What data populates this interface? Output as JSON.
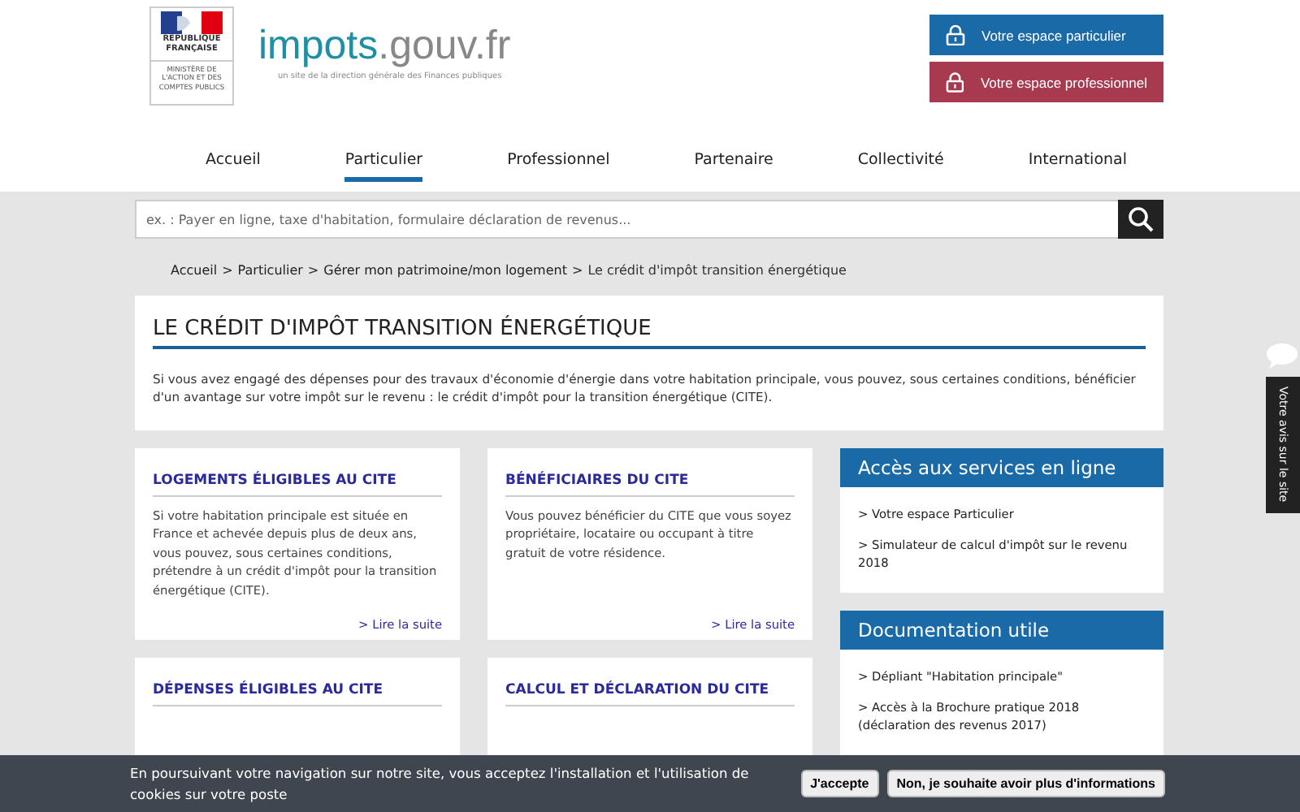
{
  "header": {
    "emblem_caption": "RÉPUBLIQUE FRANÇAISE",
    "ministry": "MINISTÈRE DE L'ACTION ET DES COMPTES PUBLICS",
    "brand_main": "impots",
    "brand_domain": ".gouv.fr",
    "tagline": "un site de la direction générale des Finances publiques",
    "account_buttons": [
      {
        "label": "Votre espace particulier",
        "color": "#1a6aa8"
      },
      {
        "label": "Votre espace professionnel",
        "color": "#a83a50"
      }
    ]
  },
  "nav": [
    {
      "label": "Accueil",
      "selected": false
    },
    {
      "label": "Particulier",
      "selected": true
    },
    {
      "label": "Professionnel",
      "selected": false
    },
    {
      "label": "Partenaire",
      "selected": false
    },
    {
      "label": "Collectivité",
      "selected": false
    },
    {
      "label": "International",
      "selected": false
    }
  ],
  "search": {
    "placeholder": "ex. : Payer en ligne, taxe d'habitation, formulaire déclaration de revenus..."
  },
  "breadcrumb": [
    {
      "text": "Accueil",
      "kind": "link"
    },
    {
      "text": ">",
      "kind": "separator"
    },
    {
      "text": "Particulier",
      "kind": "link"
    },
    {
      "text": ">",
      "kind": "separator"
    },
    {
      "text": "Gérer mon patrimoine/mon logement",
      "kind": "link"
    },
    {
      "text": ">",
      "kind": "separator"
    },
    {
      "text": "Le crédit d'impôt transition énergétique",
      "kind": "current"
    }
  ],
  "intro": {
    "title": "LE CRÉDIT D'IMPÔT TRANSITION ÉNERGÉTIQUE",
    "text": "Si vous avez engagé des dépenses pour des travaux d'économie d'énergie dans votre habitation principale, vous pouvez, sous certaines conditions, bénéficier d'un avantage sur votre impôt sur le revenu : le crédit d'impôt pour la transition énergétique (CITE)."
  },
  "cards": [
    {
      "title": "LOGEMENTS ÉLIGIBLES AU CITE",
      "text": "Si votre habitation principale est située en France et achevée depuis plus de deux ans, vous pouvez, sous certaines conditions, prétendre à un crédit d'impôt pour la transition énergétique (CITE).",
      "link": "> Lire la suite"
    },
    {
      "title": "BÉNÉFICIAIRES DU CITE",
      "text": "Vous pouvez bénéficier du CITE que vous soyez propriétaire, locataire ou occupant à titre gratuit de votre résidence.",
      "link": "> Lire la suite"
    },
    {
      "title": "DÉPENSES ÉLIGIBLES AU CITE"
    },
    {
      "title": "CALCUL ET DÉCLARATION DU CITE"
    }
  ],
  "sidebar": [
    {
      "title": "Accès aux services en ligne",
      "links": [
        "> Votre espace Particulier",
        "> Simulateur de calcul d'impôt sur le revenu 2018"
      ]
    },
    {
      "title": "Documentation utile",
      "links": [
        "> Dépliant \"Habitation principale\"",
        "> Accès à la Brochure pratique 2018 (déclaration des revenus 2017)"
      ]
    }
  ],
  "feedback_tab": {
    "label": "Votre avis sur le site"
  },
  "cookie_banner": {
    "text": "En poursuivant votre navigation sur notre site, vous acceptez l'installation et l'utilisation de cookies sur votre poste",
    "buttons": [
      "J'accepte",
      "Non, je souhaite avoir plus d'informations"
    ]
  }
}
